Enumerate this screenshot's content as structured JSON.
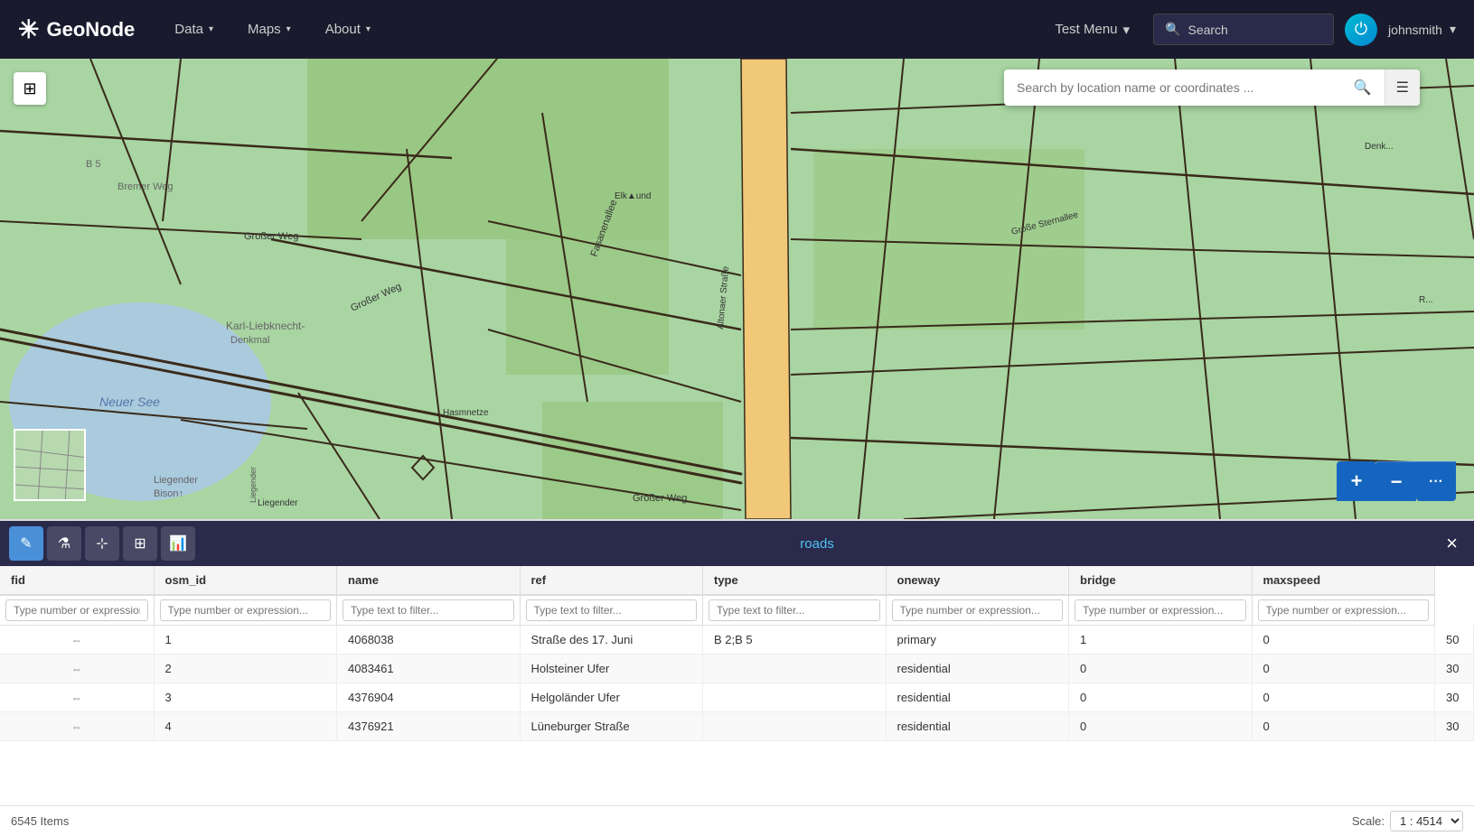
{
  "navbar": {
    "brand": "GeoNode",
    "nav_items": [
      {
        "label": "Data",
        "has_dropdown": true
      },
      {
        "label": "Maps",
        "has_dropdown": true
      },
      {
        "label": "About",
        "has_dropdown": true
      }
    ],
    "test_menu_label": "Test Menu",
    "search_placeholder": "Search",
    "search_location_placeholder": "Search by location name or coordinates ...",
    "user": "johnsmith"
  },
  "map": {
    "layer_name": "roads",
    "minimap_alt": "Minimap"
  },
  "toolbar": {
    "tools": [
      {
        "name": "draw-tool",
        "icon": "✎",
        "active": true
      },
      {
        "name": "filter-tool",
        "icon": "⚗"
      },
      {
        "name": "select-tool",
        "icon": "⊹"
      },
      {
        "name": "calculate-tool",
        "icon": "⊞"
      },
      {
        "name": "chart-tool",
        "icon": "📊"
      }
    ],
    "close_label": "×"
  },
  "table": {
    "columns": [
      {
        "key": "fid",
        "label": "fid",
        "filter_type": "number",
        "filter_placeholder": "Type number or expression..."
      },
      {
        "key": "osm_id",
        "label": "osm_id",
        "filter_type": "number",
        "filter_placeholder": "Type number or expression..."
      },
      {
        "key": "name",
        "label": "name",
        "filter_type": "text",
        "filter_placeholder": "Type text to filter..."
      },
      {
        "key": "ref",
        "label": "ref",
        "filter_type": "text",
        "filter_placeholder": "Type text to filter..."
      },
      {
        "key": "type",
        "label": "type",
        "filter_type": "text",
        "filter_placeholder": "Type text to filter..."
      },
      {
        "key": "oneway",
        "label": "oneway",
        "filter_type": "number",
        "filter_placeholder": "Type number or expression..."
      },
      {
        "key": "bridge",
        "label": "bridge",
        "filter_type": "number",
        "filter_placeholder": "Type number or expression..."
      },
      {
        "key": "maxspeed",
        "label": "maxspeed",
        "filter_type": "number",
        "filter_placeholder": "Type number or expression..."
      }
    ],
    "rows": [
      {
        "fid": "1",
        "osm_id": "4068038",
        "name": "Straße des 17. Juni",
        "ref": "B 2;B 5",
        "type": "primary",
        "oneway": "1",
        "bridge": "0",
        "maxspeed": "50"
      },
      {
        "fid": "2",
        "osm_id": "4083461",
        "name": "Holsteiner Ufer",
        "ref": "",
        "type": "residential",
        "oneway": "0",
        "bridge": "0",
        "maxspeed": "30"
      },
      {
        "fid": "3",
        "osm_id": "4376904",
        "name": "Helgoländer Ufer",
        "ref": "",
        "type": "residential",
        "oneway": "0",
        "bridge": "0",
        "maxspeed": "30"
      },
      {
        "fid": "4",
        "osm_id": "4376921",
        "name": "Lüneburger Straße",
        "ref": "",
        "type": "residential",
        "oneway": "0",
        "bridge": "0",
        "maxspeed": "30"
      }
    ],
    "total_items": "6545 Items"
  },
  "status_bar": {
    "items_label": "6545 Items",
    "scale_label": "Scale:",
    "scale_value": "1 : 4514"
  },
  "zoom": {
    "plus": "+",
    "minus": "−",
    "dots": "···"
  }
}
